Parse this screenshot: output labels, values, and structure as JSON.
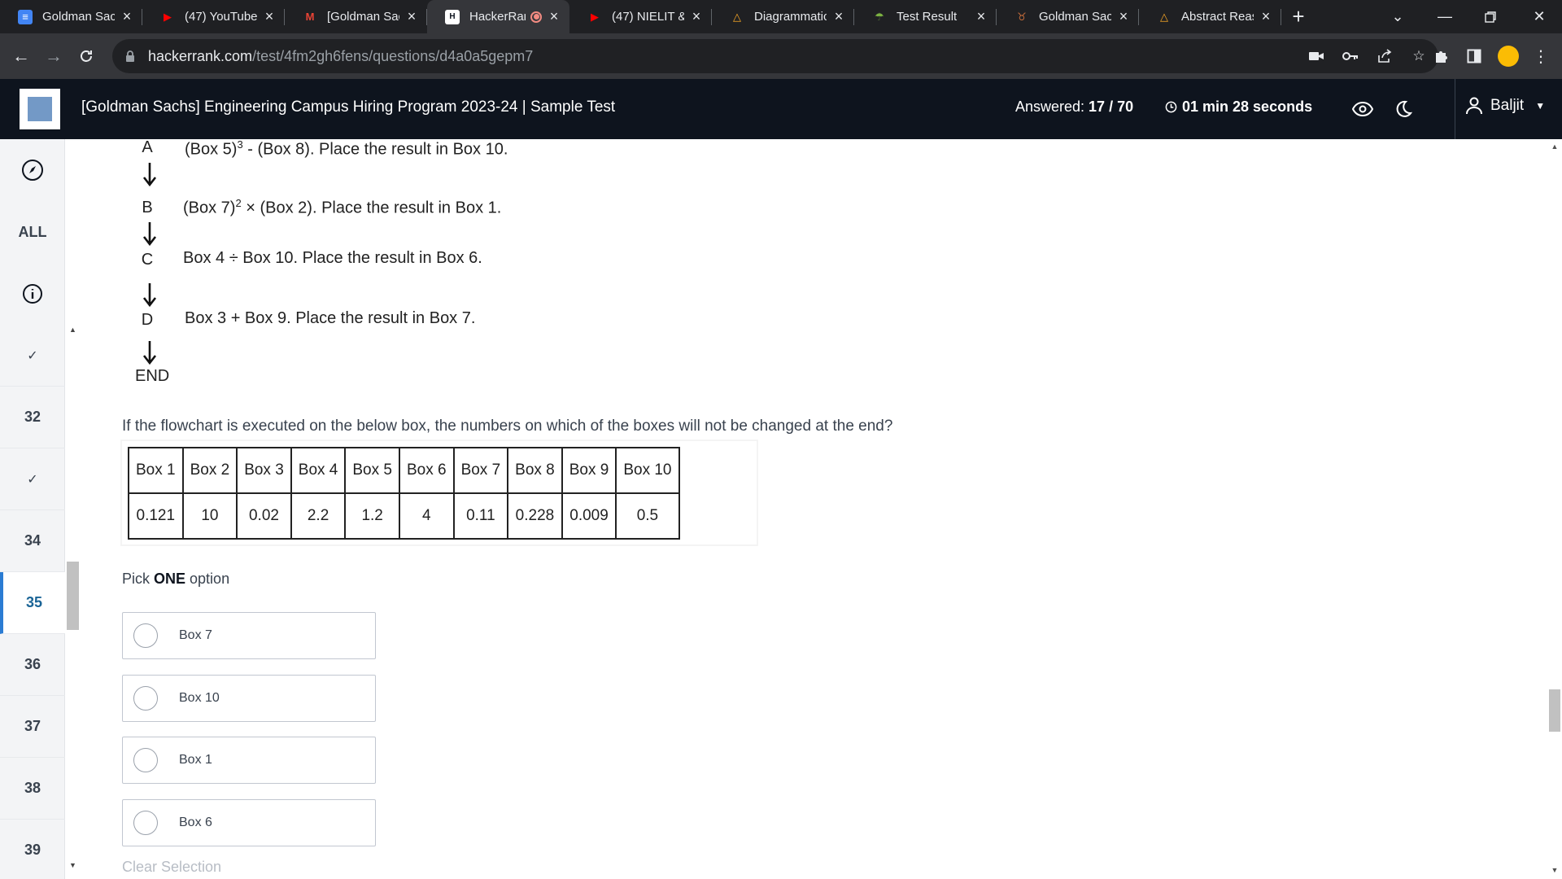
{
  "browser": {
    "tabs": [
      {
        "title": "Goldman Sachs",
        "favicon": "docs-icon",
        "fav_color": "#4285f4",
        "fav_glyph": "≡",
        "active": false
      },
      {
        "title": "(47) YouTube",
        "favicon": "youtube-icon",
        "fav_color": "#ff0000",
        "fav_glyph": "▶",
        "active": false
      },
      {
        "title": "[Goldman Sachs]",
        "favicon": "gmail-icon",
        "fav_color": "#ea4335",
        "fav_glyph": "M",
        "active": false
      },
      {
        "title": "HackerRank",
        "favicon": "hackerrank-icon",
        "fav_color": "#ffffff",
        "fav_glyph": "H",
        "active": true,
        "recording": true
      },
      {
        "title": "(47) NIELIT & ",
        "favicon": "youtube-icon",
        "fav_color": "#ff0000",
        "fav_glyph": "▶",
        "active": false
      },
      {
        "title": "Diagrammatic",
        "favicon": "warning-triangle-icon",
        "fav_color": "#f9a825",
        "fav_glyph": "△",
        "active": false
      },
      {
        "title": "Test Result",
        "favicon": "cloud-icon",
        "fav_color": "#7cb342",
        "fav_glyph": "☂",
        "active": false
      },
      {
        "title": "Goldman Sachs",
        "favicon": "mascot-icon",
        "fav_color": "#c26b3a",
        "fav_glyph": "♉",
        "active": false
      },
      {
        "title": "Abstract Reasoning",
        "favicon": "warning-triangle-icon",
        "fav_color": "#f9a825",
        "fav_glyph": "△",
        "active": false
      }
    ],
    "url_host": "hackerrank.com",
    "url_path": "/test/4fm2gh6fens/questions/d4a0a5gepm7"
  },
  "header": {
    "test_title": "[Goldman Sachs] Engineering Campus Hiring Program 2023-24 | Sample Test",
    "answered_label": "Answered: ",
    "answered_value": "17 / 70",
    "timer": "01 min 28 seconds",
    "username": "Baljit"
  },
  "sidenav": {
    "all_label": "ALL",
    "items": [
      {
        "label": "✓",
        "state": "answered"
      },
      {
        "label": "32",
        "state": "unanswered"
      },
      {
        "label": "✓",
        "state": "answered"
      },
      {
        "label": "34",
        "state": "unanswered"
      },
      {
        "label": "35",
        "state": "current"
      },
      {
        "label": "36",
        "state": "unanswered"
      },
      {
        "label": "37",
        "state": "unanswered"
      },
      {
        "label": "38",
        "state": "unanswered"
      },
      {
        "label": "39",
        "state": "unanswered"
      }
    ]
  },
  "flowchart": {
    "steps": [
      {
        "letter": "A",
        "desc_pre": "(Box 5)",
        "sup": "3",
        "desc_post": " - (Box 8). Place the result in Box 10."
      },
      {
        "letter": "B",
        "desc_pre": "(Box 7)",
        "sup": "2",
        "desc_post": " × (Box 2). Place the result in Box 1."
      },
      {
        "letter": "C",
        "desc_pre": "Box 4 ÷ Box 10. Place the result in Box 6.",
        "sup": "",
        "desc_post": ""
      },
      {
        "letter": "D",
        "desc_pre": "Box 3 + Box 9. Place the result in Box 7.",
        "sup": "",
        "desc_post": ""
      }
    ],
    "end_label": "END"
  },
  "question": {
    "text": "If the flowchart is executed on the below box, the numbers on which of the boxes will not be changed at the end?",
    "table_headers": [
      "Box 1",
      "Box 2",
      "Box 3",
      "Box 4",
      "Box 5",
      "Box 6",
      "Box 7",
      "Box 8",
      "Box 9",
      "Box 10"
    ],
    "table_values": [
      "0.121",
      "10",
      "0.02",
      "2.2",
      "1.2",
      "4",
      "0.11",
      "0.228",
      "0.009",
      "0.5"
    ],
    "pick_prefix": "Pick ",
    "pick_bold": "ONE",
    "pick_suffix": " option",
    "options": [
      "Box 7",
      "Box 10",
      "Box 1",
      "Box 6"
    ],
    "clear_label": "Clear Selection"
  },
  "colors": {
    "header_bg": "#0e141e",
    "sidenav_bg": "#f3f4f6",
    "current_accent": "#2b7cd3"
  }
}
